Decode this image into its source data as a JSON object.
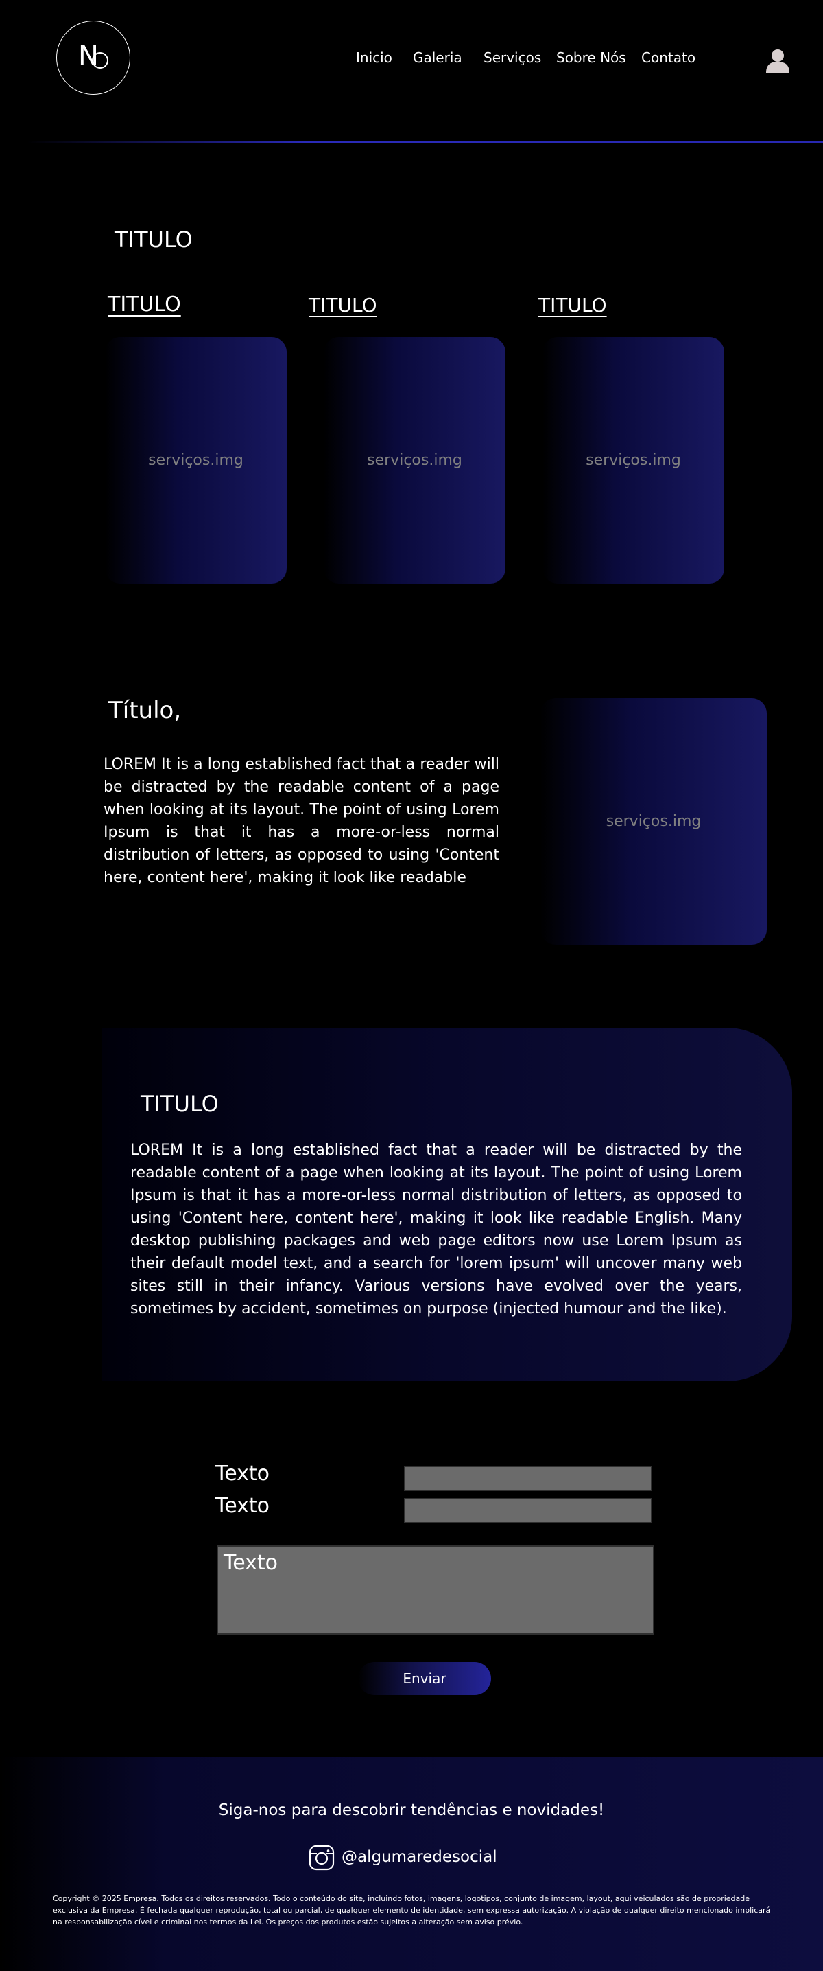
{
  "header": {
    "logo_text": "NO",
    "nav": [
      "Inicio",
      "Galeria",
      "Serviços",
      "Sobre Nós",
      "Contato"
    ]
  },
  "services": {
    "section_title": "TITULO",
    "columns": [
      {
        "title": "TITULO",
        "image_label": "serviços.img"
      },
      {
        "title": "TITULO",
        "image_label": "serviços.img"
      },
      {
        "title": "TITULO",
        "image_label": "serviços.img"
      }
    ]
  },
  "about": {
    "title": "Título,",
    "text": "LOREM It is a long established fact that a reader will be distracted by the readable content of a page when looking at its layout. The point of using Lorem Ipsum is that it has a more-or-less normal distribution of letters, as opposed to using 'Content here, content here', making it look like readable",
    "image_label": "serviços.img"
  },
  "info": {
    "title": "TITULO",
    "text": "LOREM It is a long established fact that a reader will be distracted by the readable content of a page when looking at its layout. The point of using Lorem Ipsum is that it has a more-or-less normal distribution of letters, as opposed to using 'Content here, content here', making it look like readable English. Many desktop publishing packages and web page editors now use Lorem Ipsum as their default model text, and a search for 'lorem ipsum' will uncover many web sites still in their infancy. Various versions have evolved over the years, sometimes by accident, sometimes on purpose (injected humour and the like)."
  },
  "form": {
    "label_1": "Texto",
    "label_2": "Texto",
    "textarea_text": "Texto",
    "submit_label": "Enviar"
  },
  "footer": {
    "follow_text": "Siga-nos para descobrir tendências e novidades!",
    "social_handle": "@algumaredesocial",
    "copyright": "Copyright © 2025 Empresa. Todos os direitos reservados. Todo o conteúdo do site, incluindo fotos, imagens, logotipos, conjunto de imagem, layout, aqui veiculados são de propriedade exclusiva da Empresa. É fechada qualquer reprodução, total ou parcial, de qualquer elemento de identidade, sem expressa autorização. A violação de qualquer direito mencionado implicará na responsabilização cível e criminal nos termos da Lei. Os preços dos produtos estão sujeitos a alteração sem aviso prévio."
  },
  "icons": {
    "user": "user-icon",
    "instagram": "instagram-icon"
  },
  "colors": {
    "accent": "#2a2ab8",
    "card_gradient_end": "#181860",
    "input_fill": "#6b6b6b"
  }
}
